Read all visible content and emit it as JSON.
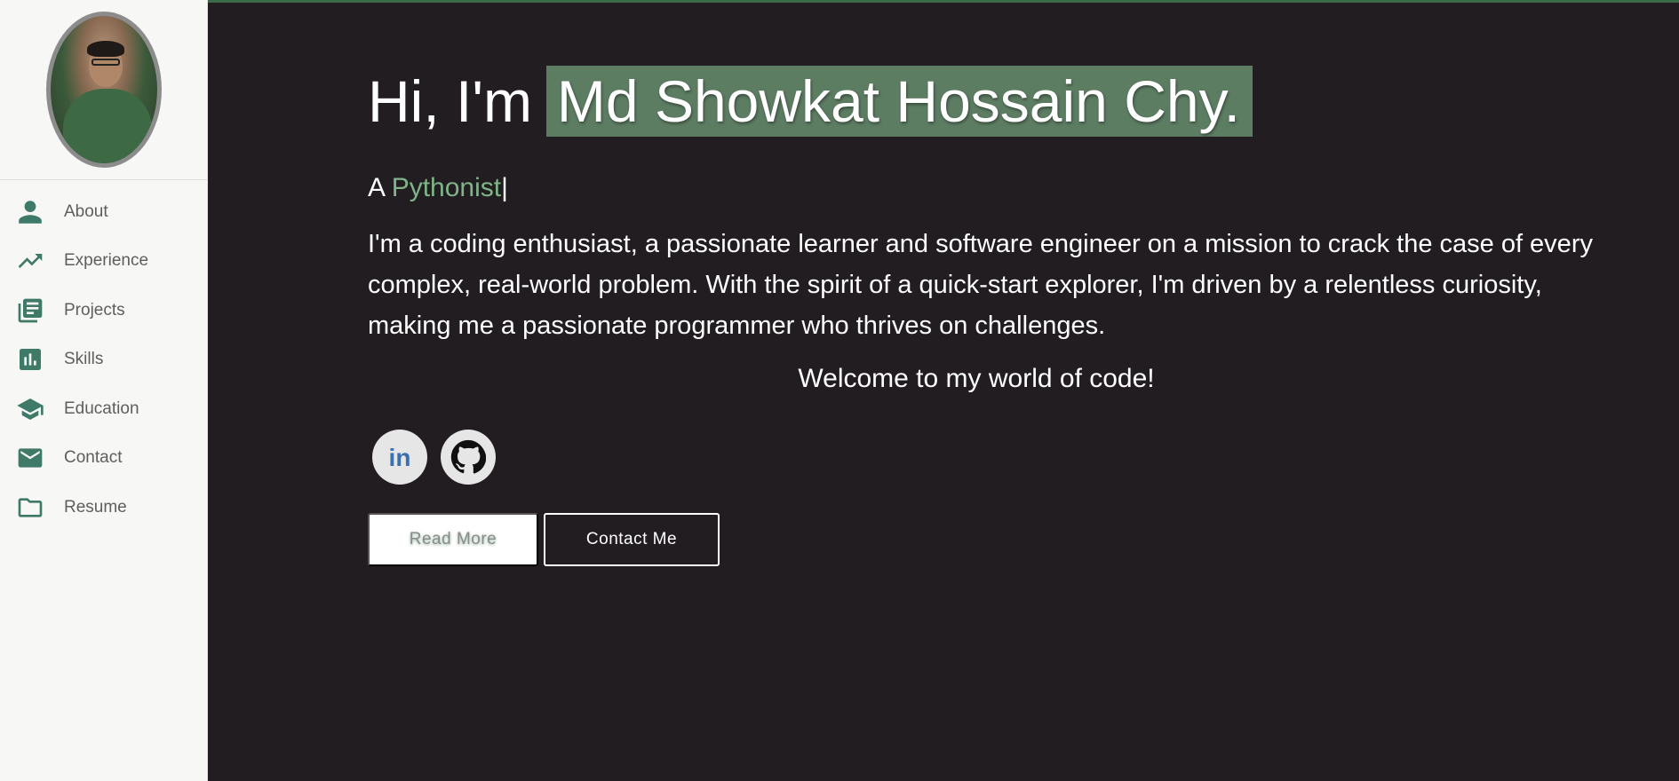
{
  "colors": {
    "background": "#221d21",
    "sidebar_bg": "#f7f7f5",
    "accent": "#3f7a68",
    "name_highlight": "#5d7d63",
    "role_accent": "#7fb588"
  },
  "sidebar": {
    "avatar_icon": "profile-photo",
    "items": [
      {
        "label": "About",
        "icon": "person-icon"
      },
      {
        "label": "Experience",
        "icon": "trending-up-icon"
      },
      {
        "label": "Projects",
        "icon": "article-icon"
      },
      {
        "label": "Skills",
        "icon": "bar-chart-icon"
      },
      {
        "label": "Education",
        "icon": "graduation-cap-icon"
      },
      {
        "label": "Contact",
        "icon": "mail-icon"
      },
      {
        "label": "Resume",
        "icon": "folder-icon"
      }
    ]
  },
  "hero": {
    "greeting": "Hi, I'm",
    "name": "Md Showkat Hossain Chy.",
    "role_prefix": "A",
    "role": "Pythonist",
    "cursor": "|",
    "bio": "I'm a coding enthusiast, a passionate learner and software engineer on a mission to crack the case of every complex, real-world problem. With the spirit of a quick-start explorer, I'm driven by a relentless curiosity, making me a passionate programmer who thrives on challenges.",
    "welcome": "Welcome to my world of code!"
  },
  "socials": [
    {
      "name": "linkedin",
      "label": "in",
      "icon": "linkedin-icon"
    },
    {
      "name": "github",
      "icon": "github-icon"
    }
  ],
  "buttons": {
    "read_more": "Read More",
    "contact_me": "Contact Me"
  }
}
